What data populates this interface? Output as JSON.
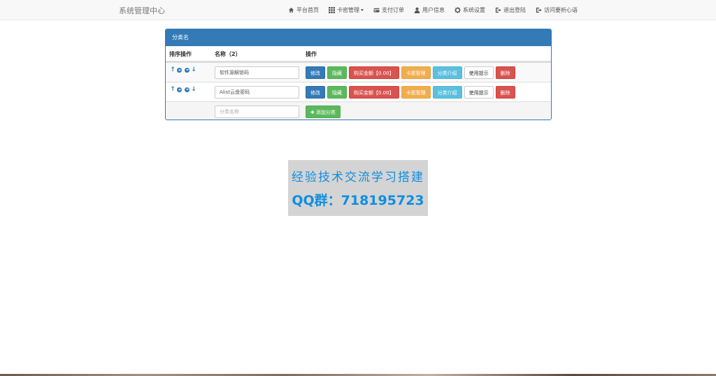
{
  "navbar": {
    "brand": "系统管理中心",
    "items": [
      {
        "label": "平台首页",
        "icon": "home-icon"
      },
      {
        "label": "卡密管理",
        "icon": "grid-icon",
        "dropdown": true
      },
      {
        "label": "支付订单",
        "icon": "credit-card-icon"
      },
      {
        "label": "用户信息",
        "icon": "user-icon"
      },
      {
        "label": "系统设置",
        "icon": "gear-icon"
      },
      {
        "label": "退出登陆",
        "icon": "logout-icon"
      },
      {
        "label": "访问要析心语",
        "icon": "logout-icon"
      }
    ]
  },
  "panel": {
    "title": "分类名",
    "columns": {
      "sort": "排序操作",
      "name": "名称（2）",
      "ops": "操作"
    },
    "rows": [
      {
        "name": "软件源解锁码"
      },
      {
        "name": "Alist云盘密码"
      }
    ],
    "buttons": {
      "edit": "修改",
      "hide": "隐藏",
      "price": "购买金额【0.00】",
      "cards": "卡密管理",
      "intro": "分类介绍",
      "tips": "使用提示",
      "delete": "删除"
    },
    "new_name_placeholder": "分类名称",
    "add_label": "添加分类"
  },
  "banner": {
    "line1": "经验技术交流学习搭建",
    "line2": "QQ群：718195723"
  },
  "colors": {
    "primary": "#337ab7",
    "success": "#5cb85c",
    "danger": "#d9534f",
    "warning": "#f0ad4e",
    "info": "#5bc0de"
  }
}
